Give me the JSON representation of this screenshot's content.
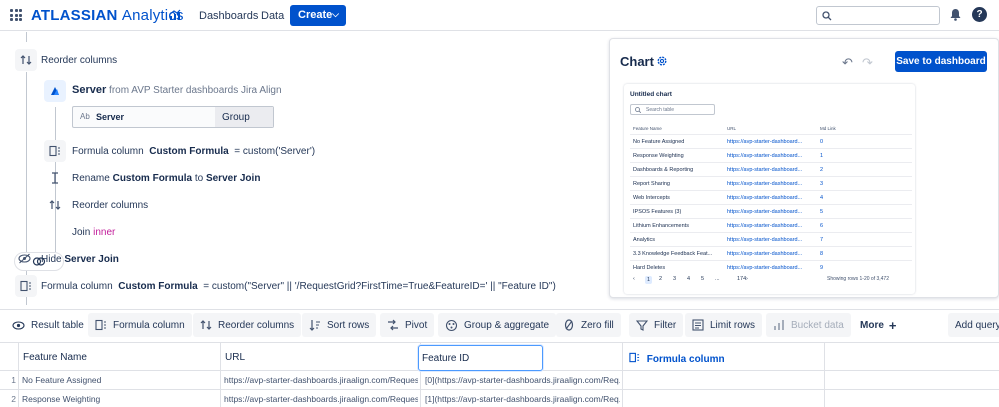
{
  "nav": {
    "brand_bold": "ATLASSIAN",
    "brand_light": "Analytics",
    "links": [
      "Dashboards",
      "Data"
    ],
    "create_label": "Create",
    "avatar_letter": "?"
  },
  "steps": {
    "reorder1": "Reorder columns",
    "server_name": "Server",
    "server_from": "from",
    "server_source": "AVP Starter dashboards Jira Align",
    "server_box_ab": "Ab",
    "server_box_name": "Server",
    "server_box_group": "Group",
    "formula1_prefix": "Formula column",
    "formula1_name": "Custom Formula",
    "formula1_expr": "=  custom('Server')",
    "rename_prefix": "Rename",
    "rename_from": "Custom Formula",
    "rename_to_word": "to",
    "rename_to": "Server Join",
    "reorder2": "Reorder columns",
    "join_prefix": "Join",
    "join_type": "inner",
    "hide_prefix": "Hide",
    "hide_name": "Server Join",
    "formula2_prefix": "Formula column",
    "formula2_name": "Custom Formula",
    "formula2_expr": "=   custom(\"Server\" || '/RequestGrid?FirstTime=True&FeatureID=' || \"Feature ID\")"
  },
  "chart_panel": {
    "title": "Chart",
    "save_label": "Save to dashboard",
    "mini": {
      "title": "Untitled chart",
      "search_placeholder": "Search table",
      "headers": [
        "Feature Name",
        "URL",
        "Md Link"
      ],
      "rows": [
        [
          "No Feature Assigned",
          "https://avp-starter-dashboard...",
          "0"
        ],
        [
          "Response Weighting",
          "https://avp-starter-dashboard...",
          "1"
        ],
        [
          "Dashboards & Reporting",
          "https://avp-starter-dashboard...",
          "2"
        ],
        [
          "Report Sharing",
          "https://avp-starter-dashboard...",
          "3"
        ],
        [
          "Web Intercepts",
          "https://avp-starter-dashboard...",
          "4"
        ],
        [
          "IPSOS Features (3)",
          "https://avp-starter-dashboard...",
          "5"
        ],
        [
          "Lithium Enhancements",
          "https://avp-starter-dashboard...",
          "6"
        ],
        [
          "Analytics",
          "https://avp-starter-dashboard...",
          "7"
        ],
        [
          "3.3 Knowledge Feedback Feat...",
          "https://avp-starter-dashboard...",
          "8"
        ],
        [
          "Hard Deletes",
          "https://avp-starter-dashboard...",
          "9"
        ]
      ],
      "pagination": {
        "prev": "‹",
        "pages": [
          "1",
          "2",
          "3",
          "4",
          "5",
          "...",
          "174"
        ],
        "next": "›",
        "active": "1"
      },
      "showing": "Showing rows 1-20 of 3,472"
    }
  },
  "toolbar": {
    "result_table": "Result table",
    "formula_column": "Formula column",
    "reorder_columns": "Reorder columns",
    "sort_rows": "Sort rows",
    "pivot": "Pivot",
    "group_aggregate": "Group & aggregate",
    "zero_fill": "Zero fill",
    "filter": "Filter",
    "limit_rows": "Limit rows",
    "bucket_data": "Bucket data",
    "more": "More",
    "add_query": "Add query"
  },
  "table": {
    "headers": [
      "Feature Name",
      "URL",
      "Feature ID",
      "Formula column"
    ],
    "rows": [
      {
        "num": "1",
        "feature_name": "No Feature Assigned",
        "url": "https://avp-starter-dashboards.jiraalign.com/Reques...",
        "feature_id": "[0](https://avp-starter-dashboards.jiraalign.com/Req..."
      },
      {
        "num": "2",
        "feature_name": "Response Weighting",
        "url": "https://avp-starter-dashboards.jiraalign.com/Reques...",
        "feature_id": "[1](https://avp-starter-dashboards.jiraalign.com/Req..."
      }
    ]
  },
  "colors": {
    "brand": "#0052cc",
    "pink": "#c21d9a",
    "focus": "#4c9aff"
  }
}
